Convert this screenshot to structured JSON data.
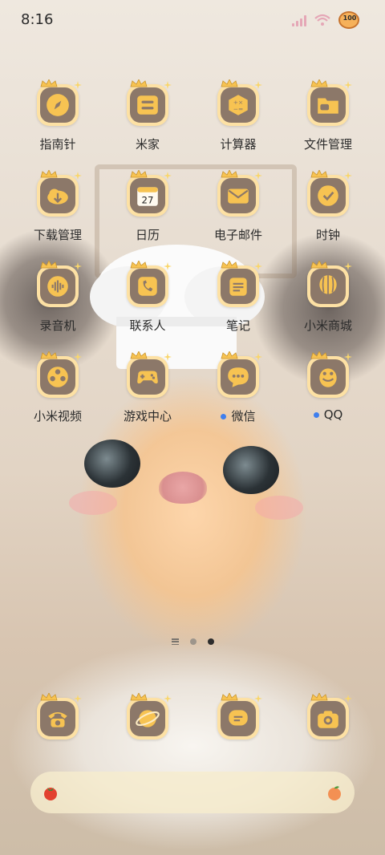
{
  "status_bar": {
    "time": "8:16",
    "battery": "100"
  },
  "apps": [
    {
      "label": "指南针",
      "icon": "compass-icon",
      "dot": false
    },
    {
      "label": "米家",
      "icon": "home-device-icon",
      "dot": false
    },
    {
      "label": "计算器",
      "icon": "calculator-icon",
      "dot": false
    },
    {
      "label": "文件管理",
      "icon": "folder-icon",
      "dot": false
    },
    {
      "label": "下载管理",
      "icon": "cloud-download-icon",
      "dot": false
    },
    {
      "label": "日历",
      "icon": "calendar-icon",
      "dot": false,
      "calendar_day": "27"
    },
    {
      "label": "电子邮件",
      "icon": "mail-icon",
      "dot": false
    },
    {
      "label": "时钟",
      "icon": "clock-icon",
      "dot": false
    },
    {
      "label": "录音机",
      "icon": "voice-recorder-icon",
      "dot": false
    },
    {
      "label": "联系人",
      "icon": "phone-book-icon",
      "dot": false
    },
    {
      "label": "笔记",
      "icon": "notes-icon",
      "dot": false
    },
    {
      "label": "小米商城",
      "icon": "shop-balloon-icon",
      "dot": false
    },
    {
      "label": "小米视频",
      "icon": "film-reel-icon",
      "dot": false
    },
    {
      "label": "游戏中心",
      "icon": "gamepad-icon",
      "dot": false
    },
    {
      "label": "微信",
      "icon": "chat-bubble-icon",
      "dot": true
    },
    {
      "label": "QQ",
      "icon": "penguin-icon",
      "dot": true
    }
  ],
  "dock": [
    {
      "icon": "telephone-icon"
    },
    {
      "icon": "planet-browser-icon"
    },
    {
      "icon": "message-icon"
    },
    {
      "icon": "camera-icon"
    }
  ],
  "page_indicator": {
    "pages": 3,
    "active_index": 2
  },
  "search_bar": {
    "left_icon": "tomato-icon",
    "right_icon": "peach-icon"
  },
  "colors": {
    "icon_outer": "#fde1a4",
    "icon_inner": "#8c7869",
    "icon_accent": "#f7c352",
    "notify_dot": "#3f7fee"
  }
}
